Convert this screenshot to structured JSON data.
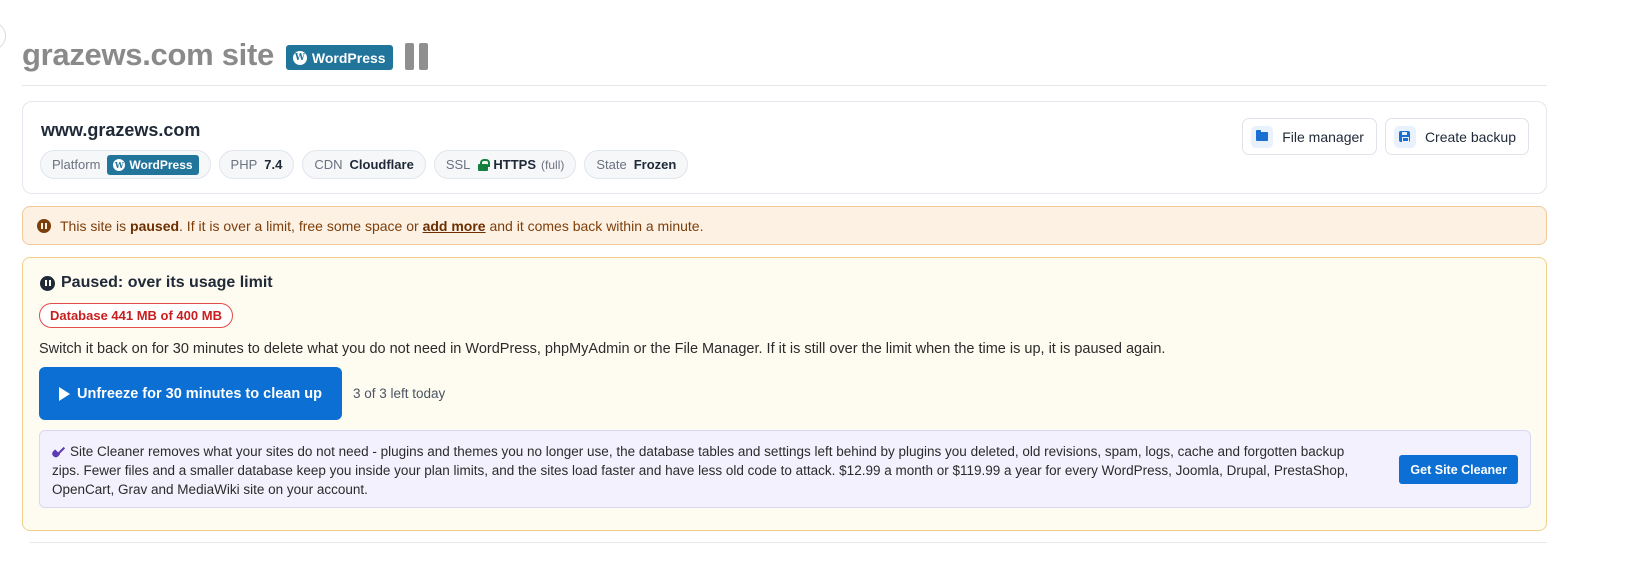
{
  "header": {
    "title": "grazews.com site",
    "platform_badge": "WordPress"
  },
  "site_card": {
    "domain": "www.grazews.com",
    "chips": {
      "platform_label": "Platform",
      "platform_value": "WordPress",
      "php_label": "PHP",
      "php_value": "7.4",
      "cdn_label": "CDN",
      "cdn_value": "Cloudflare",
      "ssl_label": "SSL",
      "ssl_value": "HTTPS",
      "ssl_mode": "(full)",
      "state_label": "State",
      "state_value": "Frozen"
    },
    "actions": {
      "file_manager": "File manager",
      "create_backup": "Create backup"
    }
  },
  "notice": {
    "text_before": "This site is",
    "bold": "paused",
    "text_middle": ". If it is over a limit, free some space or",
    "link": "add more",
    "text_after": "and it comes back within a minute."
  },
  "paused_panel": {
    "title": "Paused: over its usage limit",
    "usage_badge": "Database 441 MB of 400 MB",
    "usage": {
      "resource": "Database",
      "used_mb": 441,
      "limit_mb": 400
    },
    "description": "Switch it back on for 30 minutes to delete what you do not need in WordPress, phpMyAdmin or the File Manager. If it is still over the limit when the time is up, it is paused again.",
    "unfreeze_button": "Unfreeze for 30 minutes to clean up",
    "remaining": "3 of 3 left today"
  },
  "site_cleaner": {
    "text": "Site Cleaner removes what your sites do not need - plugins and themes you no longer use, the database tables and settings left behind by plugins you deleted, old revisions, spam, logs, cache and forgotten backup zips. Fewer files and a smaller database keep you inside your plan limits, and the sites load faster and have less old code to attack. $12.99 a month or $119.99 a year for every WordPress, Joomla, Drupal, PrestaShop, OpenCart, Grav and MediaWiki site on your account.",
    "button": "Get Site Cleaner"
  },
  "colors": {
    "wordpress_blue": "#21759b",
    "primary_button": "#0b6fd3",
    "notice_background": "#fdf1e4",
    "paused_background": "#fefbf0",
    "danger": "#c81e1e",
    "ssl_green": "#15803d"
  }
}
